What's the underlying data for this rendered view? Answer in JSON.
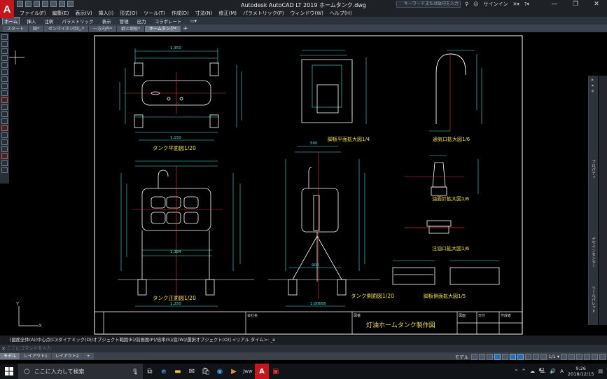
{
  "titlebar": {
    "app_letter": "A",
    "window_title": "Autodesk AutoCAD LT 2019   ホームタンク.dwg",
    "search_placeholder": "キーワードまたは語句を入力",
    "signin": "サインイン"
  },
  "menubar": [
    "ファイル(F)",
    "編集(E)",
    "表示(V)",
    "挿入(I)",
    "形式(O)",
    "ツール(T)",
    "作成(D)",
    "寸法(N)",
    "修正(M)",
    "パラメトリック(P)",
    "ウィンドウ(W)",
    "ヘルプ(H)"
  ],
  "ribbon_tabs": [
    {
      "label": "ホーム",
      "active": true
    },
    {
      "label": "挿入"
    },
    {
      "label": "注釈"
    },
    {
      "label": "パラメトリック"
    },
    {
      "label": "表示"
    },
    {
      "label": "管理"
    },
    {
      "label": "出力"
    },
    {
      "label": "コラボレート"
    },
    {
      "label": "▭▾"
    }
  ],
  "file_tabs": [
    {
      "label": "スタート"
    },
    {
      "label": "図*"
    },
    {
      "label": "ゼンマイネジ回し*"
    },
    {
      "label": "一方向弁*"
    },
    {
      "label": "鋼と鋼板*"
    },
    {
      "label": "ホームタンク*",
      "active": true
    }
  ],
  "drawing": {
    "views": {
      "tank_plan": "タンク平面図1/20",
      "tank_front": "タンク正面図1/20",
      "tank_side": "タンク側面図1/20",
      "leg_plan": "脚板平面拡大図1/4",
      "vent": "通気口拡大図1/6",
      "gauge": "油面計拡大図1/6",
      "filler": "注油口拡大図1/6",
      "leg_side": "脚板側面拡大図1/5"
    },
    "dims": {
      "plan_width": "1,350",
      "plan_base": "1,150",
      "front_width": "1,250",
      "front_base": "1,384",
      "side_width": "1,00695",
      "side_top": "500",
      "side_mid": "900"
    },
    "title_block": {
      "company_label": "会社名",
      "drawing_title": "灯油ホームタンク製作図",
      "field1": "図番",
      "field2": "図面",
      "field3": "日付",
      "field4": "作成者"
    }
  },
  "right_palette": {
    "label_top": "プロパティ",
    "label_mid": "デザインセンター",
    "label_bottom": "ツールパレット"
  },
  "command": {
    "history": "[図面全体(A)/中心点(C)/ダイナミック(D)/オブジェクト範囲(E)/前画面(P)/倍率(S)/窓(W)/選択オブジェクト(O)] <リアル タイム>: _e",
    "placeholder": "ここにコマンドを入力"
  },
  "layout_tabs": [
    {
      "label": "モデル",
      "active": true
    },
    {
      "label": "レイアウト1"
    },
    {
      "label": "レイアウト2"
    },
    {
      "label": "+"
    }
  ],
  "status": {
    "model": "モデル",
    "scale": "1/1 ▾"
  },
  "taskbar": {
    "search_text": "ここに入力して検索",
    "time": "9:26",
    "date": "2018/12/15",
    "ime": "A"
  }
}
